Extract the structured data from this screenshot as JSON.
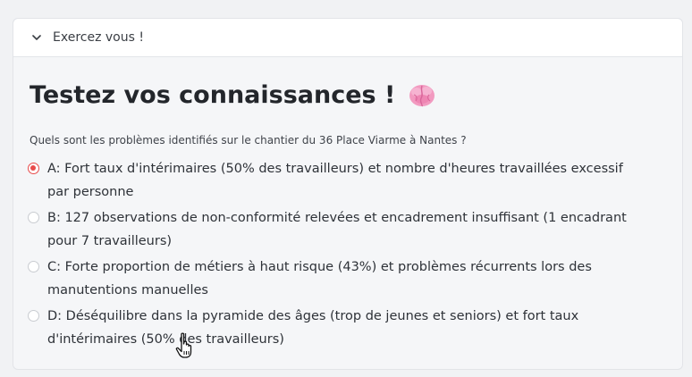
{
  "header": {
    "title": "Exercez vous !",
    "chevron_icon": "chevron-down-icon"
  },
  "quiz": {
    "title": "Testez vos connaissances !",
    "title_icon": "brain-icon",
    "question": "Quels sont les problèmes identifiés sur le chantier du 36 Place Viarme à Nantes ?",
    "selected_option": "A",
    "options": [
      {
        "letter": "A",
        "text": "A: Fort taux d'intérimaires (50% des travailleurs) et nombre d'heures travaillées excessif par personne",
        "selected": true
      },
      {
        "letter": "B",
        "text": "B: 127 observations de non-conformité relevées et encadrement insuffisant (1 encadrant pour 7 travailleurs)",
        "selected": false
      },
      {
        "letter": "C",
        "text": "C: Forte proportion de métiers à haut risque (43%) et problèmes récurrents lors des manutentions manuelles",
        "selected": false
      },
      {
        "letter": "D",
        "text": "D: Déséquilibre dans la pyramide des âges (trop de jeunes et seniors) et fort taux d'intérimaires (50% des travailleurs)",
        "selected": false
      }
    ]
  },
  "colors": {
    "accent": "#e84b4b",
    "text": "#2e3238",
    "background": "#f5f6f8"
  }
}
